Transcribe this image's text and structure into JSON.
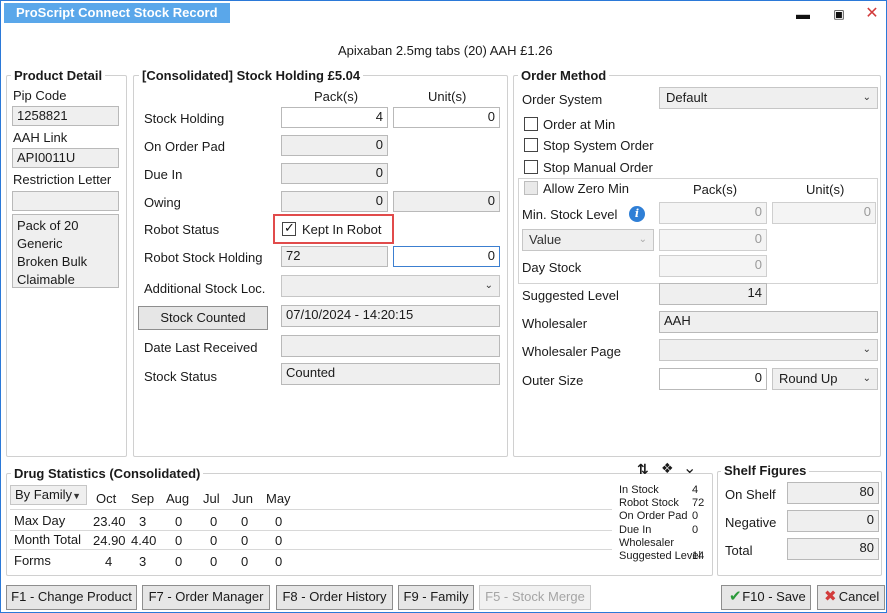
{
  "window": {
    "title": "ProScript Connect Stock Record",
    "subtitle": "Apixaban 2.5mg tabs (20) AAH £1.26"
  },
  "product_detail": {
    "title": "Product Detail",
    "pip_label": "Pip Code",
    "pip_value": "1258821",
    "aah_label": "AAH Link",
    "aah_value": "API0011U",
    "restriction_label": "Restriction Letter",
    "restriction_value": "",
    "notes": [
      "Pack of 20",
      "Generic",
      "Broken Bulk",
      "Claimable"
    ]
  },
  "stock_holding": {
    "title": "[Consolidated] Stock Holding £5.04",
    "packs_header": "Pack(s)",
    "units_header": "Unit(s)",
    "stock_holding_label": "Stock Holding",
    "stock_holding_packs": "4",
    "stock_holding_units": "0",
    "on_order_pad_label": "On Order Pad",
    "on_order_pad_packs": "0",
    "due_in_label": "Due In",
    "due_in_packs": "0",
    "owing_label": "Owing",
    "owing_packs": "0",
    "owing_units": "0",
    "robot_status_label": "Robot Status",
    "kept_in_robot_label": "Kept In Robot",
    "robot_stock_label": "Robot Stock Holding",
    "robot_stock_packs": "72",
    "robot_stock_units": "0",
    "additional_loc_label": "Additional Stock Loc.",
    "stock_counted_button": "Stock Counted",
    "stock_counted_value": "07/10/2024 - 14:20:15",
    "date_last_received_label": "Date Last Received",
    "date_last_received_value": "",
    "stock_status_label": "Stock Status",
    "stock_status_value": "Counted"
  },
  "order_method": {
    "title": "Order Method",
    "order_system_label": "Order System",
    "order_system_value": "Default",
    "order_at_min_label": "Order at Min",
    "stop_system_order_label": "Stop System Order",
    "stop_manual_order_label": "Stop Manual Order",
    "allow_zero_min_label": "Allow Zero Min",
    "packs_header": "Pack(s)",
    "units_header": "Unit(s)",
    "min_stock_label": "Min. Stock Level",
    "min_stock_packs": "0",
    "min_stock_units": "0",
    "value_combo": "Value",
    "value_packs": "0",
    "day_stock_label": "Day Stock",
    "day_stock_packs": "0",
    "suggested_level_label": "Suggested Level",
    "suggested_level_value": "14",
    "wholesaler_label": "Wholesaler",
    "wholesaler_value": "AAH",
    "wholesaler_page_label": "Wholesaler Page",
    "outer_size_label": "Outer Size",
    "outer_size_value": "0",
    "round_combo": "Round Up"
  },
  "drug_statistics": {
    "title": "Drug Statistics (Consolidated)",
    "family_combo": "By Family",
    "months": [
      "Oct",
      "Sep",
      "Aug",
      "Jul",
      "Jun",
      "May"
    ],
    "rows": [
      {
        "label": "Max Day",
        "values": [
          "23.40",
          "3",
          "0",
          "0",
          "0",
          "0"
        ]
      },
      {
        "label": "Month Total",
        "values": [
          "24.90",
          "4.40",
          "0",
          "0",
          "0",
          "0"
        ]
      },
      {
        "label": "Forms",
        "values": [
          "4",
          "3",
          "0",
          "0",
          "0",
          "0"
        ]
      }
    ],
    "summary": [
      {
        "label": "In Stock",
        "value": "4"
      },
      {
        "label": "Robot Stock",
        "value": "72"
      },
      {
        "label": "On Order Pad",
        "value": "0"
      },
      {
        "label": "Due In",
        "value": "0"
      },
      {
        "label": "Wholesaler",
        "value": ""
      },
      {
        "label": "Suggested Level",
        "value": "14"
      }
    ]
  },
  "shelf_figures": {
    "title": "Shelf Figures",
    "on_shelf_label": "On Shelf",
    "on_shelf_value": "80",
    "negative_label": "Negative",
    "negative_value": "0",
    "total_label": "Total",
    "total_value": "80"
  },
  "footer": {
    "f1": "F1 - Change Product",
    "f7": "F7 - Order Manager",
    "f8": "F8 - Order History",
    "f9": "F9 - Family",
    "f5": "F5 - Stock Merge",
    "f10": "F10 - Save",
    "cancel": "Cancel"
  },
  "colors": {
    "title_bg": "#5aa7ea",
    "highlight": "#e14b4b",
    "save_check": "#2a9a3a",
    "cancel_x": "#d23b3b",
    "close_x": "#d23b3b"
  }
}
